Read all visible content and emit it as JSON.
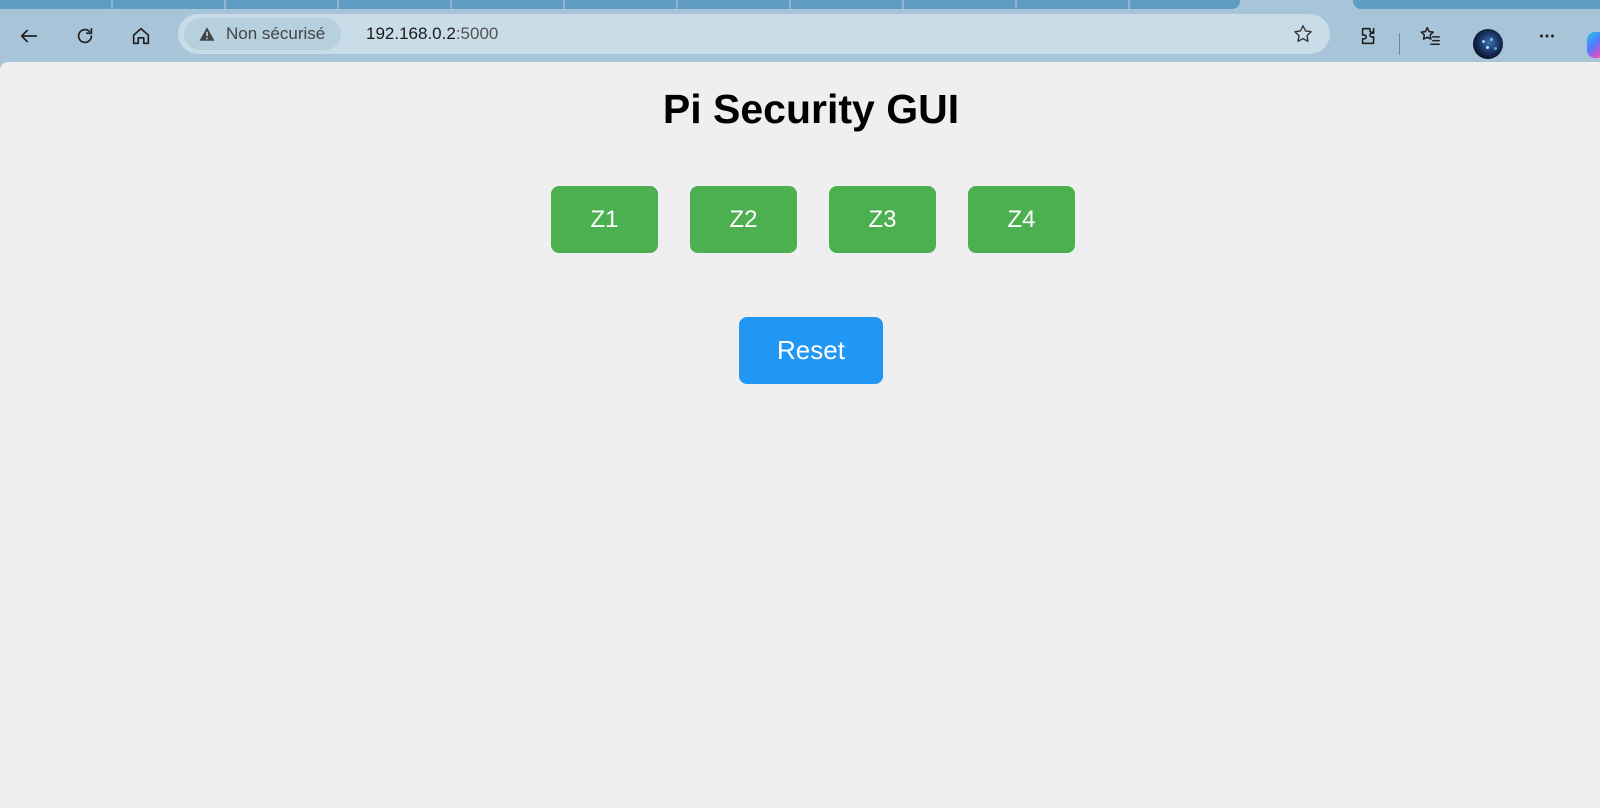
{
  "browser": {
    "security_label": "Non sécurisé",
    "url_host": "192.168.0.2",
    "url_port": ":5000",
    "icons": [
      "back-icon",
      "refresh-icon",
      "home-icon",
      "warning-icon",
      "favorite-star-icon",
      "extensions-icon",
      "favorites-icon",
      "profile-avatar",
      "more-icon",
      "copilot-icon"
    ]
  },
  "page": {
    "title": "Pi Security GUI",
    "zones": [
      {
        "label": "Z1"
      },
      {
        "label": "Z2"
      },
      {
        "label": "Z3"
      },
      {
        "label": "Z4"
      }
    ],
    "reset_label": "Reset",
    "colors": {
      "zone_button": "#4caf50",
      "reset_button": "#2196f3",
      "background": "#efefef"
    }
  }
}
